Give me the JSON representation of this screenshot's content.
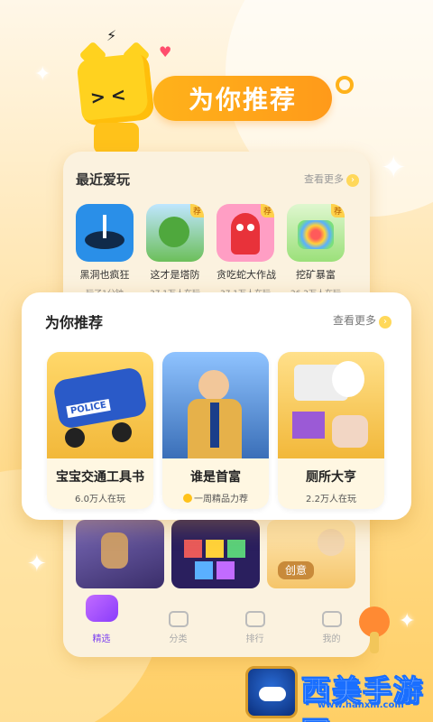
{
  "banner": {
    "title": "为你推荐"
  },
  "recent": {
    "header": "最近爱玩",
    "more": "查看更多",
    "items": [
      {
        "name": "黑洞也疯狂",
        "stat": "玩了1分钟",
        "tag": "",
        "color": "#2a8fe8"
      },
      {
        "name": "这才是塔防",
        "stat": "37.1万人在玩",
        "tag": "荐",
        "color": "#6cbf5a"
      },
      {
        "name": "贪吃蛇大作战",
        "stat": "37.1万人在玩",
        "tag": "荐",
        "color": "#ff6da5"
      },
      {
        "name": "挖矿暴富",
        "stat": "26.2万人在玩",
        "tag": "荐",
        "color": "#9be07a"
      }
    ]
  },
  "recommend": {
    "header": "为你推荐",
    "more": "查看更多",
    "items": [
      {
        "name": "宝宝交通工具书",
        "stat": "6.0万人在玩",
        "color": "#2a5ac8",
        "badge": "POLICE"
      },
      {
        "name": "谁是首富",
        "stat": "一周精品力荐",
        "color": "#e6b14a"
      },
      {
        "name": "厕所大亨",
        "stat": "2.2万人在玩",
        "color": "#f2b83a"
      }
    ]
  },
  "bottom_tiles": [
    {
      "caption": "",
      "color": "#5b4a9a"
    },
    {
      "caption": "",
      "color": "#3a2a7a"
    },
    {
      "caption": "创意",
      "color": "#f5c56a"
    }
  ],
  "tabs": [
    {
      "label": "精选",
      "active": true
    },
    {
      "label": "分类",
      "active": false
    },
    {
      "label": "排行",
      "active": false
    },
    {
      "label": "我的",
      "active": false
    }
  ],
  "watermark": {
    "title": "西美手游网",
    "url": "www.hanxm.com"
  }
}
